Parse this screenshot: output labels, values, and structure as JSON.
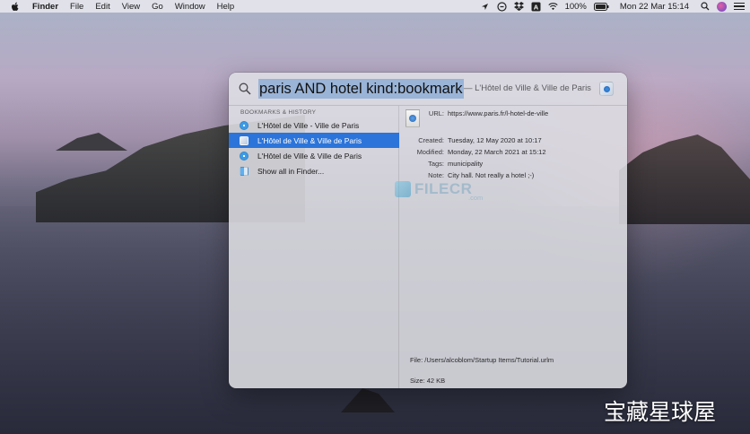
{
  "menubar": {
    "app_name": "Finder",
    "menus": [
      "File",
      "Edit",
      "View",
      "Go",
      "Window",
      "Help"
    ],
    "battery": "100%",
    "datetime": "Mon 22 Mar  15:14",
    "status_icons": [
      "location-arrow-icon",
      "link-icon",
      "dropbox-icon",
      "keyboard-input-icon",
      "wifi-icon",
      "battery-icon",
      "search-icon",
      "avatar",
      "control-center-icon"
    ]
  },
  "spotlight": {
    "query": "paris AND hotel  kind:bookmark",
    "hint": "— L'Hôtel de Ville & Ville de Paris",
    "section_header": "BOOKMARKS & HISTORY",
    "results": [
      {
        "label": "L'Hôtel de Ville - Ville de Paris",
        "icon": "safari-icon",
        "selected": false
      },
      {
        "label": "L'Hôtel de Ville & Ville de Paris",
        "icon": "bookmark-file-icon",
        "selected": true
      },
      {
        "label": "L'Hôtel de Ville & Ville de Paris",
        "icon": "safari-icon",
        "selected": false
      },
      {
        "label": "Show all in Finder...",
        "icon": "finder-icon",
        "selected": false
      }
    ],
    "preview": {
      "url_label": "URL:",
      "url_value": "https://www.paris.fr/l-hotel-de-ville",
      "created_label": "Created:",
      "created_value": "Tuesday, 12 May 2020 at 10:17",
      "modified_label": "Modified:",
      "modified_value": "Monday, 22 March 2021 at 15:12",
      "tags_label": "Tags:",
      "tags_value": "municipality",
      "note_label": "Note:",
      "note_value": "City hall. Not really a hotel ;-)",
      "file_path": "File:  /Users/alcoblom/Startup Items/Tutorial.urlm",
      "size": "Size:  42 KB"
    }
  },
  "watermark": {
    "text": "FILECR",
    "sub": ".com"
  },
  "corner_brand": "宝藏星球屋",
  "colors": {
    "selection": "#2c74d9",
    "query_highlight": "#9ab4d8"
  }
}
